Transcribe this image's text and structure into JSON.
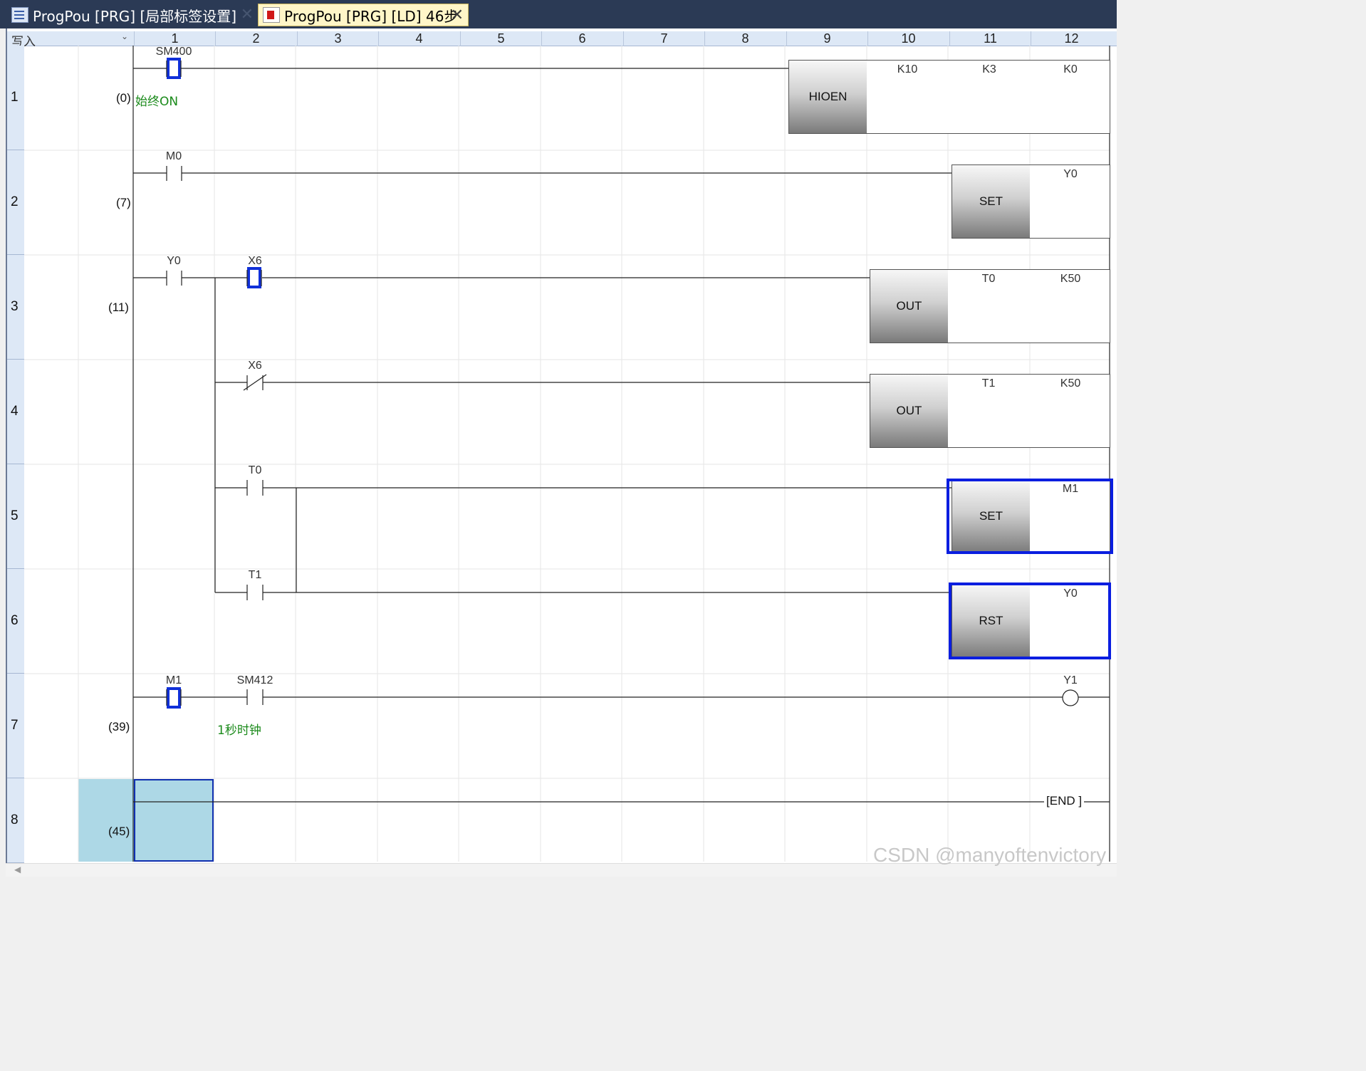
{
  "tabs": [
    {
      "label": "ProgPou [PRG] [局部标签设置]",
      "icon": "table-icon",
      "active": false
    },
    {
      "label": "ProgPou [PRG] [LD] 46步",
      "icon": "ladder-icon",
      "active": true
    }
  ],
  "column_header": {
    "mode": "写入",
    "columns": [
      "1",
      "2",
      "3",
      "4",
      "5",
      "6",
      "7",
      "8",
      "9",
      "10",
      "11",
      "12"
    ]
  },
  "rows": [
    {
      "num": "1",
      "step": "(0)"
    },
    {
      "num": "2",
      "step": "(7)"
    },
    {
      "num": "3",
      "step": "(11)"
    },
    {
      "num": "4",
      "step": ""
    },
    {
      "num": "5",
      "step": ""
    },
    {
      "num": "6",
      "step": ""
    },
    {
      "num": "7",
      "step": "(39)"
    },
    {
      "num": "8",
      "step": "(45)"
    }
  ],
  "contacts": {
    "r1_sm400": "SM400",
    "r1_comment": "始终ON",
    "r2_m0": "M0",
    "r3_y0": "Y0",
    "r3_x6": "X6",
    "r4_x6": "X6",
    "r5_t0": "T0",
    "r6_t1": "T1",
    "r7_m1": "M1",
    "r7_sm412": "SM412",
    "r7_comment": "1秒时钟"
  },
  "instructions": {
    "r1": {
      "op": "HIOEN",
      "args": [
        "K10",
        "K3",
        "K0"
      ]
    },
    "r2": {
      "op": "SET",
      "args": [
        "Y0"
      ]
    },
    "r3": {
      "op": "OUT",
      "args": [
        "T0",
        "K50"
      ]
    },
    "r4": {
      "op": "OUT",
      "args": [
        "T1",
        "K50"
      ]
    },
    "r5": {
      "op": "SET",
      "args": [
        "M1"
      ]
    },
    "r6": {
      "op": "RST",
      "args": [
        "Y0"
      ]
    },
    "r7_coil": "Y1",
    "end": "END"
  },
  "watermark": "CSDN @manyoftenvictory",
  "colors": {
    "highlight": "#0a1ee0",
    "comment": "#1a8a1a",
    "cursor": "#add8e6",
    "tab_active": "#fff6c8"
  }
}
